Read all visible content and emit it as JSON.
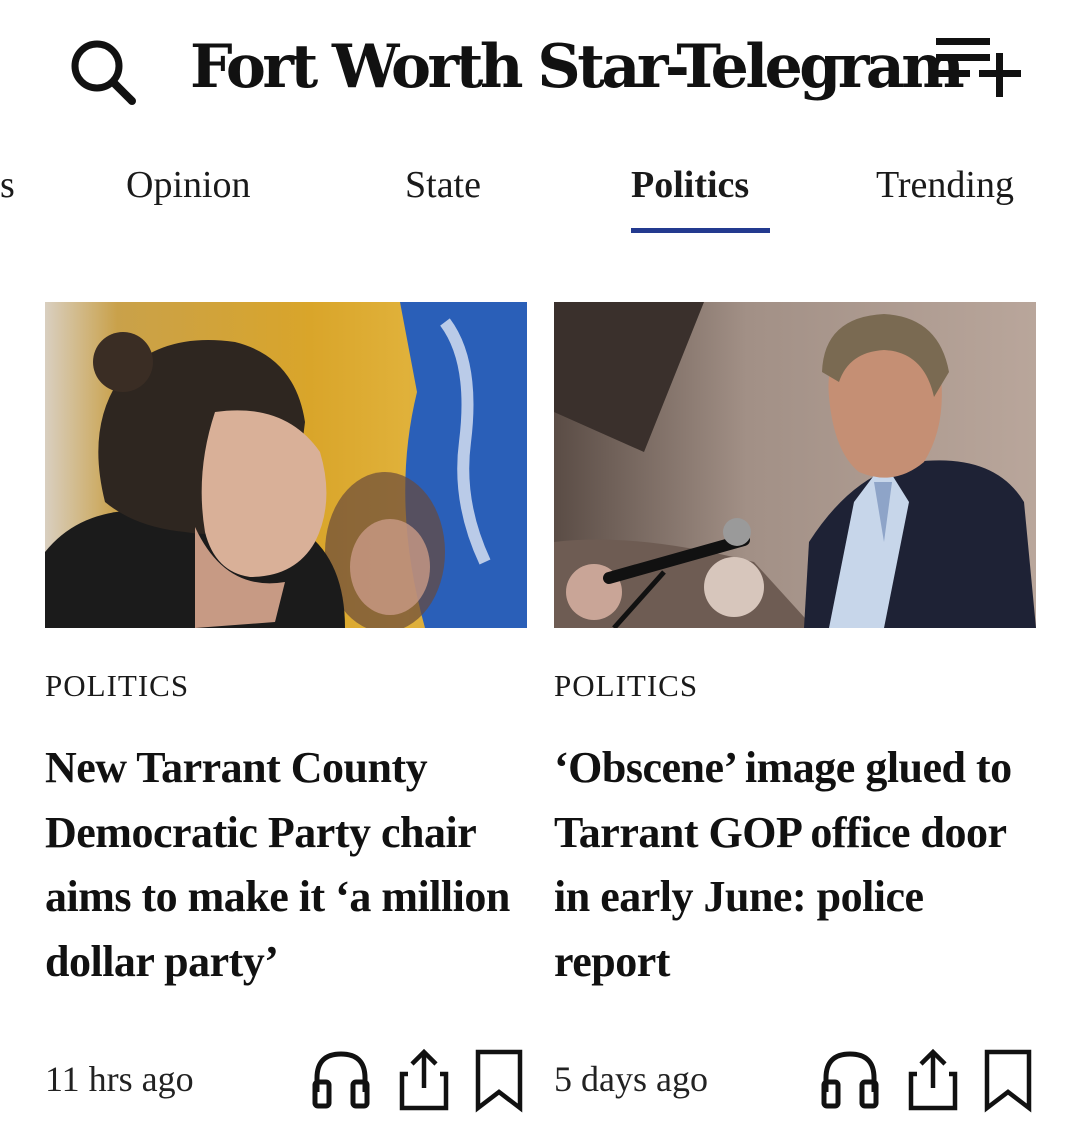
{
  "header": {
    "masthead": "Fort Worth Star-Telegram",
    "search_icon": "search-icon",
    "playlist_icon": "playlist-add-icon"
  },
  "nav": {
    "tabs": [
      {
        "label": "s"
      },
      {
        "label": "Opinion"
      },
      {
        "label": "State"
      },
      {
        "label": "Politics",
        "active": true
      },
      {
        "label": "Trending"
      }
    ],
    "accent_color": "#233a8f"
  },
  "articles": [
    {
      "kicker": "POLITICS",
      "headline": "New Tarrant County Democratic Party chair aims to make it ‘a million dollar party’",
      "time": "11 hrs ago",
      "icons": [
        "headphones-icon",
        "share-icon",
        "bookmark-icon"
      ]
    },
    {
      "kicker": "POLITICS",
      "headline": "‘Obscene’ image glued to Tarrant GOP office door in early June: police report",
      "time": "5 days ago",
      "icons": [
        "headphones-icon",
        "share-icon",
        "bookmark-icon"
      ]
    }
  ]
}
